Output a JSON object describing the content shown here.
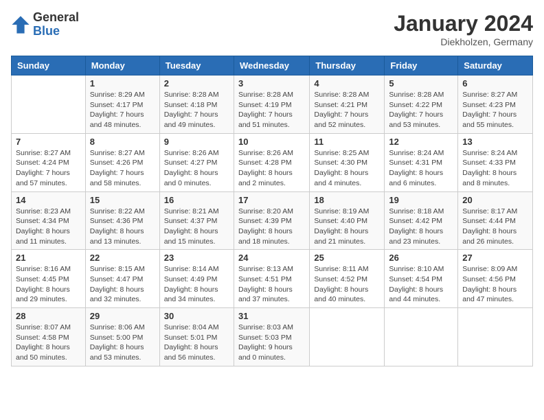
{
  "logo": {
    "general": "General",
    "blue": "Blue"
  },
  "title": "January 2024",
  "location": "Diekholzen, Germany",
  "days": [
    "Sunday",
    "Monday",
    "Tuesday",
    "Wednesday",
    "Thursday",
    "Friday",
    "Saturday"
  ],
  "weeks": [
    [
      {
        "date": "",
        "sunrise": "",
        "sunset": "",
        "daylight": ""
      },
      {
        "date": "1",
        "sunrise": "Sunrise: 8:29 AM",
        "sunset": "Sunset: 4:17 PM",
        "daylight": "Daylight: 7 hours and 48 minutes."
      },
      {
        "date": "2",
        "sunrise": "Sunrise: 8:28 AM",
        "sunset": "Sunset: 4:18 PM",
        "daylight": "Daylight: 7 hours and 49 minutes."
      },
      {
        "date": "3",
        "sunrise": "Sunrise: 8:28 AM",
        "sunset": "Sunset: 4:19 PM",
        "daylight": "Daylight: 7 hours and 51 minutes."
      },
      {
        "date": "4",
        "sunrise": "Sunrise: 8:28 AM",
        "sunset": "Sunset: 4:21 PM",
        "daylight": "Daylight: 7 hours and 52 minutes."
      },
      {
        "date": "5",
        "sunrise": "Sunrise: 8:28 AM",
        "sunset": "Sunset: 4:22 PM",
        "daylight": "Daylight: 7 hours and 53 minutes."
      },
      {
        "date": "6",
        "sunrise": "Sunrise: 8:27 AM",
        "sunset": "Sunset: 4:23 PM",
        "daylight": "Daylight: 7 hours and 55 minutes."
      }
    ],
    [
      {
        "date": "7",
        "sunrise": "Sunrise: 8:27 AM",
        "sunset": "Sunset: 4:24 PM",
        "daylight": "Daylight: 7 hours and 57 minutes."
      },
      {
        "date": "8",
        "sunrise": "Sunrise: 8:27 AM",
        "sunset": "Sunset: 4:26 PM",
        "daylight": "Daylight: 7 hours and 58 minutes."
      },
      {
        "date": "9",
        "sunrise": "Sunrise: 8:26 AM",
        "sunset": "Sunset: 4:27 PM",
        "daylight": "Daylight: 8 hours and 0 minutes."
      },
      {
        "date": "10",
        "sunrise": "Sunrise: 8:26 AM",
        "sunset": "Sunset: 4:28 PM",
        "daylight": "Daylight: 8 hours and 2 minutes."
      },
      {
        "date": "11",
        "sunrise": "Sunrise: 8:25 AM",
        "sunset": "Sunset: 4:30 PM",
        "daylight": "Daylight: 8 hours and 4 minutes."
      },
      {
        "date": "12",
        "sunrise": "Sunrise: 8:24 AM",
        "sunset": "Sunset: 4:31 PM",
        "daylight": "Daylight: 8 hours and 6 minutes."
      },
      {
        "date": "13",
        "sunrise": "Sunrise: 8:24 AM",
        "sunset": "Sunset: 4:33 PM",
        "daylight": "Daylight: 8 hours and 8 minutes."
      }
    ],
    [
      {
        "date": "14",
        "sunrise": "Sunrise: 8:23 AM",
        "sunset": "Sunset: 4:34 PM",
        "daylight": "Daylight: 8 hours and 11 minutes."
      },
      {
        "date": "15",
        "sunrise": "Sunrise: 8:22 AM",
        "sunset": "Sunset: 4:36 PM",
        "daylight": "Daylight: 8 hours and 13 minutes."
      },
      {
        "date": "16",
        "sunrise": "Sunrise: 8:21 AM",
        "sunset": "Sunset: 4:37 PM",
        "daylight": "Daylight: 8 hours and 15 minutes."
      },
      {
        "date": "17",
        "sunrise": "Sunrise: 8:20 AM",
        "sunset": "Sunset: 4:39 PM",
        "daylight": "Daylight: 8 hours and 18 minutes."
      },
      {
        "date": "18",
        "sunrise": "Sunrise: 8:19 AM",
        "sunset": "Sunset: 4:40 PM",
        "daylight": "Daylight: 8 hours and 21 minutes."
      },
      {
        "date": "19",
        "sunrise": "Sunrise: 8:18 AM",
        "sunset": "Sunset: 4:42 PM",
        "daylight": "Daylight: 8 hours and 23 minutes."
      },
      {
        "date": "20",
        "sunrise": "Sunrise: 8:17 AM",
        "sunset": "Sunset: 4:44 PM",
        "daylight": "Daylight: 8 hours and 26 minutes."
      }
    ],
    [
      {
        "date": "21",
        "sunrise": "Sunrise: 8:16 AM",
        "sunset": "Sunset: 4:45 PM",
        "daylight": "Daylight: 8 hours and 29 minutes."
      },
      {
        "date": "22",
        "sunrise": "Sunrise: 8:15 AM",
        "sunset": "Sunset: 4:47 PM",
        "daylight": "Daylight: 8 hours and 32 minutes."
      },
      {
        "date": "23",
        "sunrise": "Sunrise: 8:14 AM",
        "sunset": "Sunset: 4:49 PM",
        "daylight": "Daylight: 8 hours and 34 minutes."
      },
      {
        "date": "24",
        "sunrise": "Sunrise: 8:13 AM",
        "sunset": "Sunset: 4:51 PM",
        "daylight": "Daylight: 8 hours and 37 minutes."
      },
      {
        "date": "25",
        "sunrise": "Sunrise: 8:11 AM",
        "sunset": "Sunset: 4:52 PM",
        "daylight": "Daylight: 8 hours and 40 minutes."
      },
      {
        "date": "26",
        "sunrise": "Sunrise: 8:10 AM",
        "sunset": "Sunset: 4:54 PM",
        "daylight": "Daylight: 8 hours and 44 minutes."
      },
      {
        "date": "27",
        "sunrise": "Sunrise: 8:09 AM",
        "sunset": "Sunset: 4:56 PM",
        "daylight": "Daylight: 8 hours and 47 minutes."
      }
    ],
    [
      {
        "date": "28",
        "sunrise": "Sunrise: 8:07 AM",
        "sunset": "Sunset: 4:58 PM",
        "daylight": "Daylight: 8 hours and 50 minutes."
      },
      {
        "date": "29",
        "sunrise": "Sunrise: 8:06 AM",
        "sunset": "Sunset: 5:00 PM",
        "daylight": "Daylight: 8 hours and 53 minutes."
      },
      {
        "date": "30",
        "sunrise": "Sunrise: 8:04 AM",
        "sunset": "Sunset: 5:01 PM",
        "daylight": "Daylight: 8 hours and 56 minutes."
      },
      {
        "date": "31",
        "sunrise": "Sunrise: 8:03 AM",
        "sunset": "Sunset: 5:03 PM",
        "daylight": "Daylight: 9 hours and 0 minutes."
      },
      {
        "date": "",
        "sunrise": "",
        "sunset": "",
        "daylight": ""
      },
      {
        "date": "",
        "sunrise": "",
        "sunset": "",
        "daylight": ""
      },
      {
        "date": "",
        "sunrise": "",
        "sunset": "",
        "daylight": ""
      }
    ]
  ]
}
